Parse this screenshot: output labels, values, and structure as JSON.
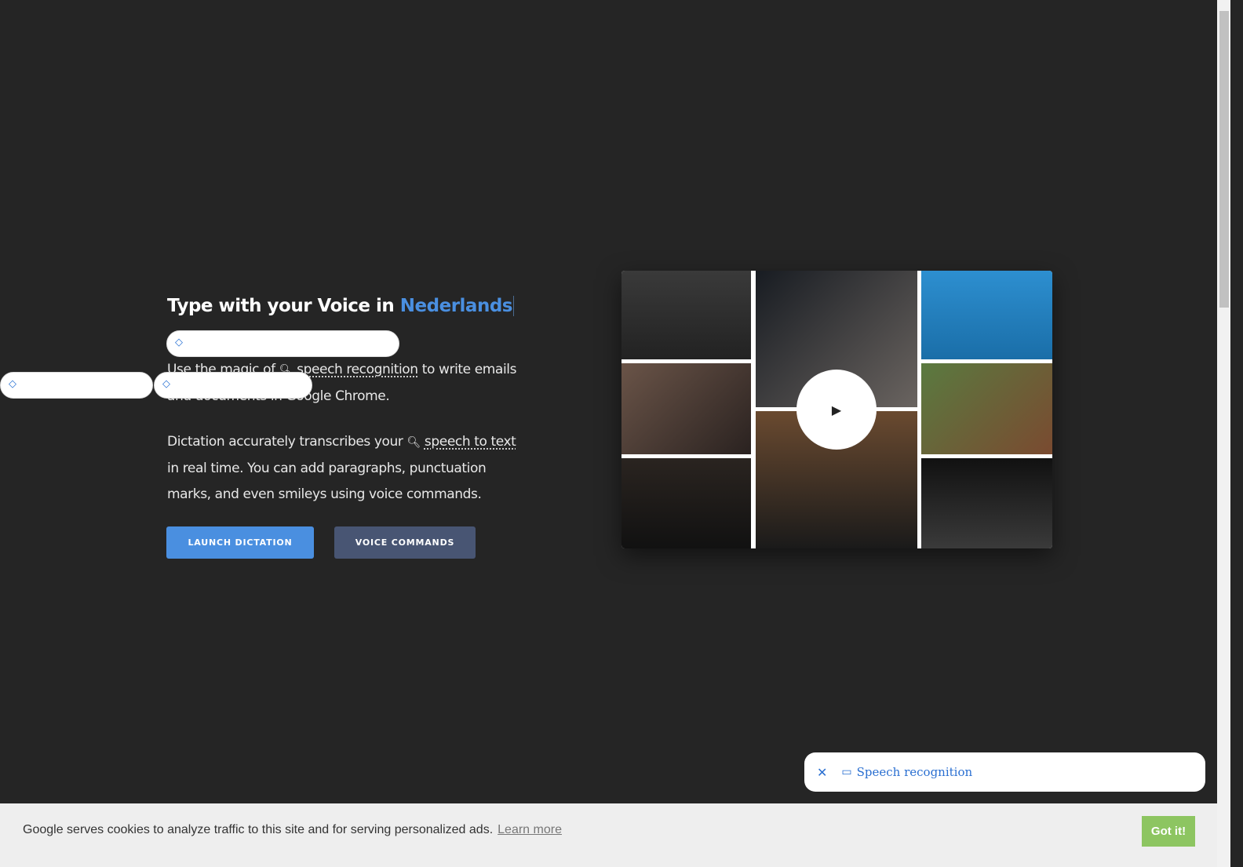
{
  "hero": {
    "title_prefix": "Type with your Voice in",
    "language": "Nederlands",
    "p1_a": "Use the magic of",
    "p1_link": "speech recognition",
    "p1_b": "to write emails and documents in Google Chrome.",
    "p2_a": "Dictation accurately transcribes your",
    "p2_link": "speech to text",
    "p2_b": "in real time. You can add paragraphs, punctuation marks, and even smileys using voice commands.",
    "launch_label": "LAUNCH DICTATION",
    "commands_label": "VOICE COMMANDS"
  },
  "colors": {
    "accent": "#4a8fe0",
    "launch": "#4a8fe0",
    "commands": "#485573",
    "got_it": "#8dc561"
  },
  "video": {
    "play_icon": "▶"
  },
  "toast": {
    "label": "Speech recognition",
    "close_icon": "✕"
  },
  "cookie": {
    "message": "Google serves cookies to analyze traffic to this site and for serving personalized ads.",
    "learn_more": "Learn more",
    "got_it": "Got it!"
  }
}
